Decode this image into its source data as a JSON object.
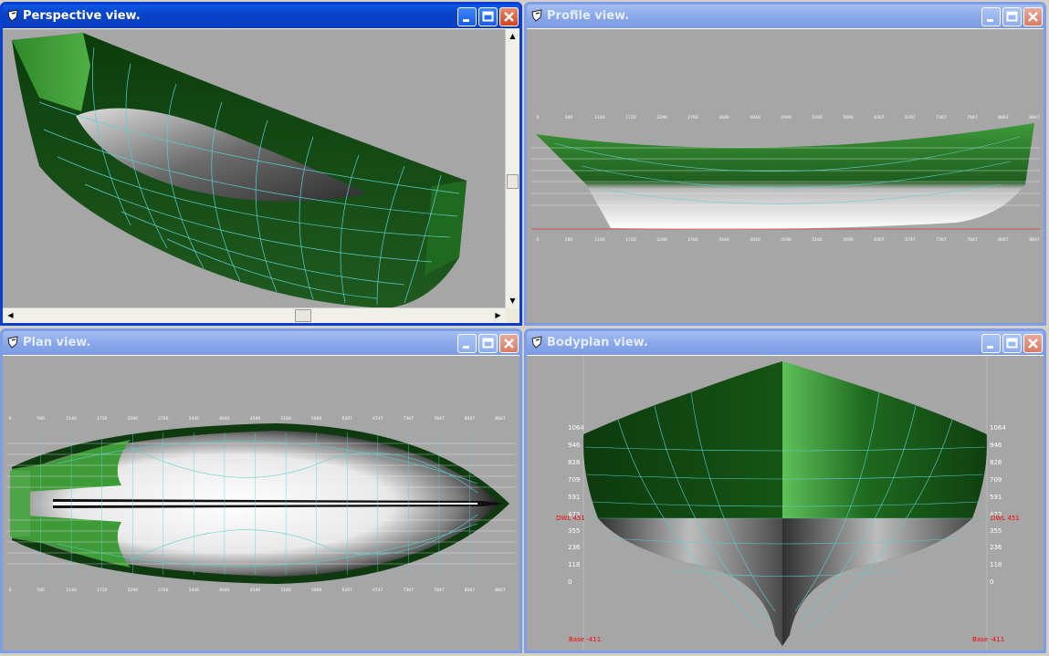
{
  "windows": {
    "perspective": {
      "title": "Perspective view."
    },
    "profile": {
      "title": "Profile view."
    },
    "plan": {
      "title": "Plan view."
    },
    "bodyplan": {
      "title": "Bodyplan view."
    }
  },
  "station_labels": [
    "0",
    "580",
    "1140",
    "1720",
    "2290",
    "2760",
    "3440",
    "4040",
    "4590",
    "5160",
    "5690",
    "6307",
    "6747",
    "7307",
    "7847",
    "8067",
    "8847"
  ],
  "bodyplan": {
    "height_labels": [
      "1064",
      "946",
      "828",
      "709",
      "591",
      "473",
      "355",
      "236",
      "118",
      "0"
    ],
    "dwl_left": "DWL 451",
    "dwl_right": "DWL 451",
    "base_left": "Base -411",
    "base_right": "Base -411"
  },
  "colors": {
    "active_title": "#0a4fd9",
    "hull_green": "#2f8a2a",
    "grid_line": "#5bd0d0",
    "marker_red": "#ff0000"
  },
  "icons": {
    "window_icon": "app-icon",
    "minimize": "minimize-icon",
    "maximize": "maximize-icon",
    "close": "close-icon"
  }
}
